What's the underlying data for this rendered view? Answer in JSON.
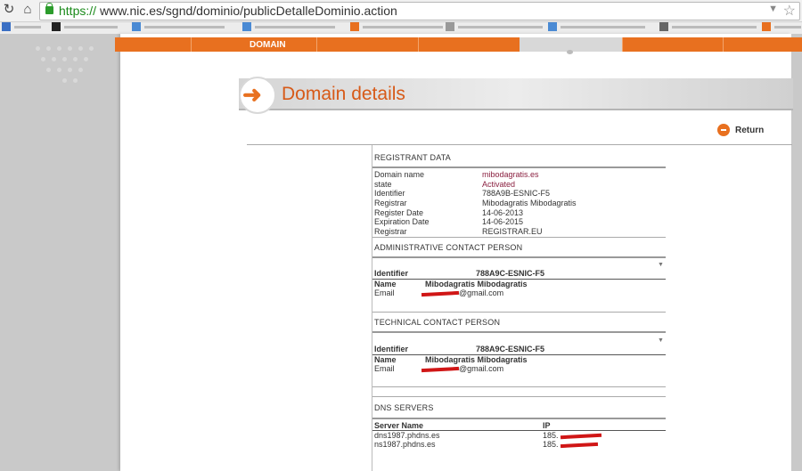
{
  "browser": {
    "url_scheme": "https://",
    "url_path": "www.nic.es/sgnd/dominio/publicDetalleDominio.action"
  },
  "nav": {
    "domain_label": "DOMAIN"
  },
  "page": {
    "title": "Domain details",
    "return_label": "Return"
  },
  "registrant": {
    "heading": "REGISTRANT DATA",
    "rows": [
      {
        "label": "Domain name",
        "value": "mibodagratis.es"
      },
      {
        "label": "state",
        "value": "Activated"
      },
      {
        "label": "Identifier",
        "value": "788A9B-ESNIC-F5"
      },
      {
        "label": "Registrar",
        "value": "Mibodagratis Mibodagratis"
      },
      {
        "label": "Register Date",
        "value": "14-06-2013"
      },
      {
        "label": "Expiration Date",
        "value": "14-06-2015"
      },
      {
        "label": "Registrar",
        "value": "REGISTRAR.EU"
      }
    ]
  },
  "admin_contact": {
    "heading": "ADMINISTRATIVE CONTACT PERSON",
    "identifier_label": "Identifier",
    "identifier_value": "788A9C-ESNIC-F5",
    "name_label": "Name",
    "name_value": "Mibodagratis Mibodagratis",
    "email_label": "Email",
    "email_value": "@gmail.com"
  },
  "tech_contact": {
    "heading": "TECHNICAL CONTACT PERSON",
    "identifier_label": "Identifier",
    "identifier_value": "788A9C-ESNIC-F5",
    "name_label": "Name",
    "name_value": "Mibodagratis Mibodagratis",
    "email_label": "Email",
    "email_value": "@gmail.com"
  },
  "dns": {
    "heading": "DNS SERVERS",
    "col_server": "Server Name",
    "col_ip": "IP",
    "servers": [
      {
        "name": "dns1987.phdns.es",
        "ip": "185."
      },
      {
        "name": "ns1987.phdns.es",
        "ip": "185."
      }
    ]
  },
  "colors": {
    "accent": "#e8701f",
    "title": "#d75a18",
    "value_highlight": "#8a2040",
    "redaction": "#d01616"
  }
}
